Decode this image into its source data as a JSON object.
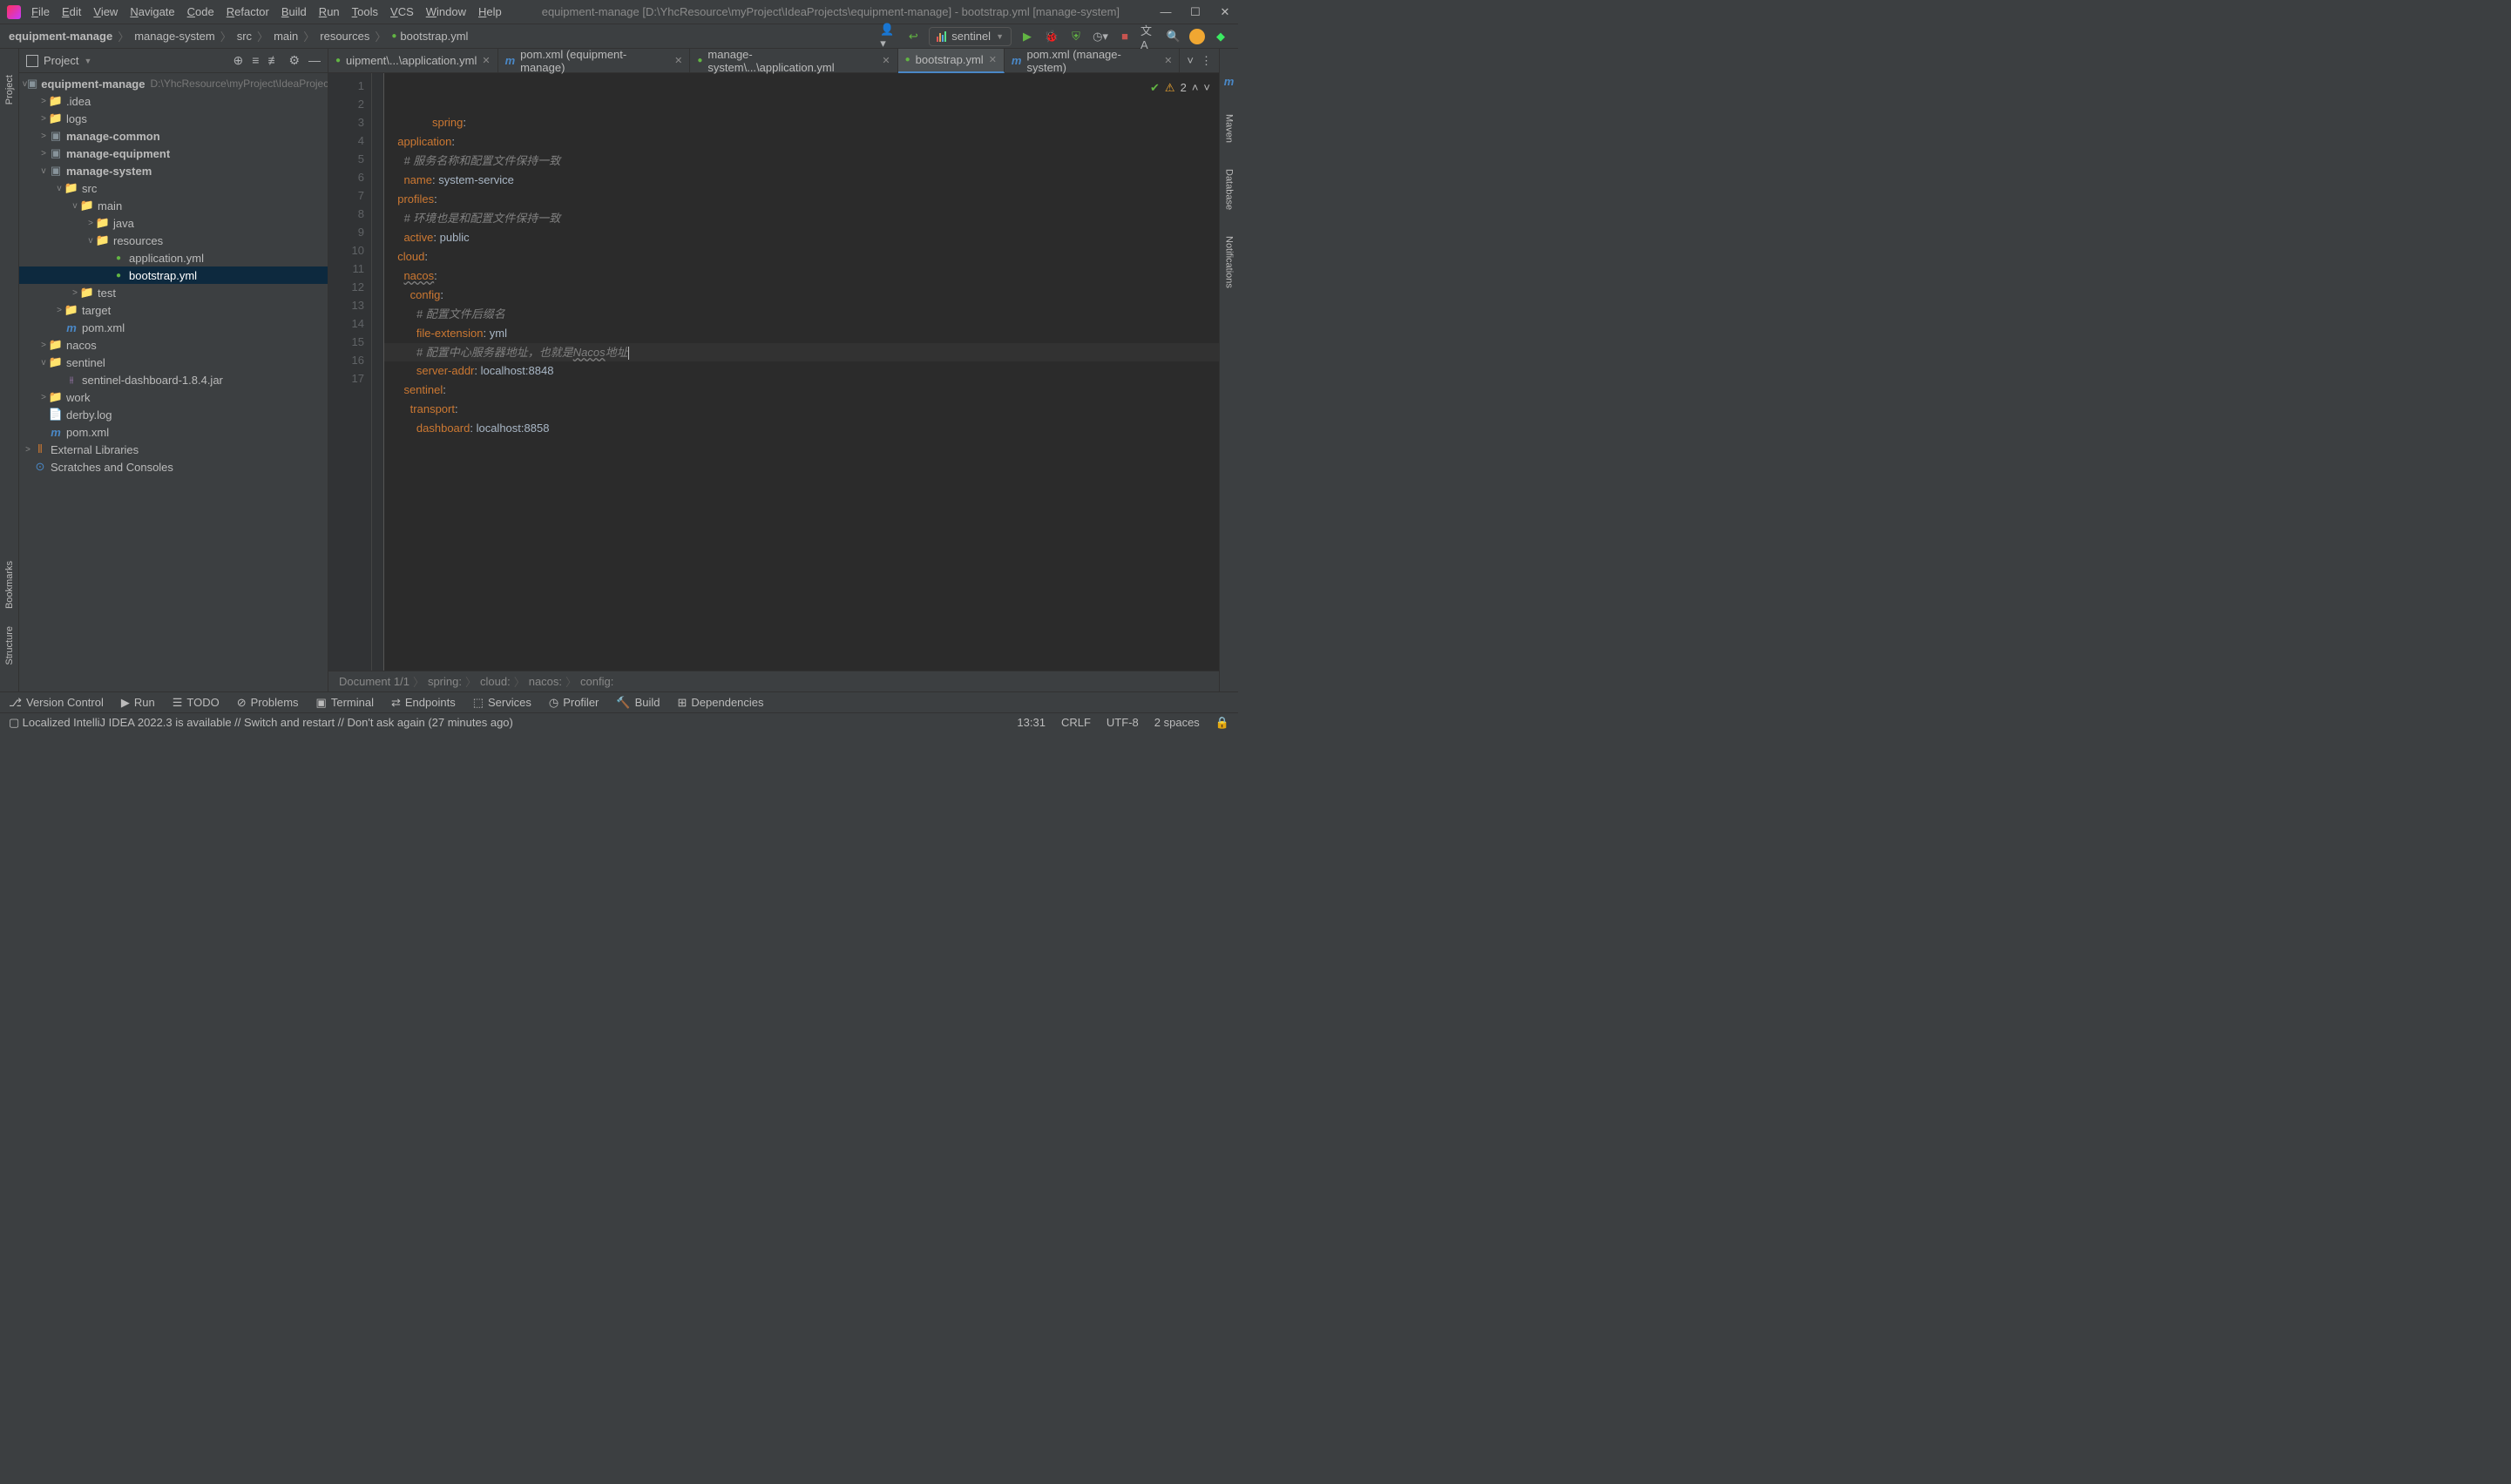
{
  "titlebar": {
    "menus": [
      "File",
      "Edit",
      "View",
      "Navigate",
      "Code",
      "Refactor",
      "Build",
      "Run",
      "Tools",
      "VCS",
      "Window",
      "Help"
    ],
    "title": "equipment-manage [D:\\YhcResource\\myProject\\IdeaProjects\\equipment-manage] - bootstrap.yml [manage-system]"
  },
  "breadcrumb": [
    "equipment-manage",
    "manage-system",
    "src",
    "main",
    "resources",
    "bootstrap.yml"
  ],
  "run_config": "sentinel",
  "sidebar": {
    "title": "Project",
    "root": {
      "name": "equipment-manage",
      "path": "D:\\YhcResource\\myProject\\IdeaProjects\\equipment-manage"
    },
    "items": [
      {
        "lvl": 1,
        "arrow": ">",
        "type": "folder",
        "label": ".idea"
      },
      {
        "lvl": 1,
        "arrow": ">",
        "type": "folder",
        "label": "logs"
      },
      {
        "lvl": 1,
        "arrow": ">",
        "type": "module",
        "label": "manage-common"
      },
      {
        "lvl": 1,
        "arrow": ">",
        "type": "module",
        "label": "manage-equipment"
      },
      {
        "lvl": 1,
        "arrow": "v",
        "type": "module",
        "label": "manage-system"
      },
      {
        "lvl": 2,
        "arrow": "v",
        "type": "src",
        "label": "src"
      },
      {
        "lvl": 3,
        "arrow": "v",
        "type": "src",
        "label": "main"
      },
      {
        "lvl": 4,
        "arrow": ">",
        "type": "src",
        "label": "java"
      },
      {
        "lvl": 4,
        "arrow": "v",
        "type": "res",
        "label": "resources"
      },
      {
        "lvl": 5,
        "arrow": "",
        "type": "yml",
        "label": "application.yml"
      },
      {
        "lvl": 5,
        "arrow": "",
        "type": "yml",
        "label": "bootstrap.yml",
        "selected": true
      },
      {
        "lvl": 3,
        "arrow": ">",
        "type": "folder",
        "label": "test"
      },
      {
        "lvl": 2,
        "arrow": ">",
        "type": "target",
        "label": "target"
      },
      {
        "lvl": 2,
        "arrow": "",
        "type": "pom",
        "label": "pom.xml"
      },
      {
        "lvl": 1,
        "arrow": ">",
        "type": "folder",
        "label": "nacos"
      },
      {
        "lvl": 1,
        "arrow": "v",
        "type": "folder",
        "label": "sentinel"
      },
      {
        "lvl": 2,
        "arrow": "",
        "type": "jar",
        "label": "sentinel-dashboard-1.8.4.jar"
      },
      {
        "lvl": 1,
        "arrow": ">",
        "type": "folder",
        "label": "work"
      },
      {
        "lvl": 1,
        "arrow": "",
        "type": "file",
        "label": "derby.log"
      },
      {
        "lvl": 1,
        "arrow": "",
        "type": "pom",
        "label": "pom.xml"
      }
    ],
    "ext_lib": "External Libraries",
    "scratches": "Scratches and Consoles"
  },
  "tabs": [
    {
      "label": "uipment\\...\\application.yml",
      "type": "yml",
      "active": false
    },
    {
      "label": "pom.xml (equipment-manage)",
      "type": "pom",
      "active": false
    },
    {
      "label": "manage-system\\...\\application.yml",
      "type": "yml",
      "active": false
    },
    {
      "label": "bootstrap.yml",
      "type": "yml",
      "active": true
    },
    {
      "label": "pom.xml (manage-system)",
      "type": "pom",
      "active": false
    }
  ],
  "code": {
    "lines": [
      {
        "n": 1,
        "html": "<span class='k'>spring</span>:"
      },
      {
        "n": 2,
        "html": "  <span class='k'>application</span>:"
      },
      {
        "n": 3,
        "html": "    <span class='c'># 服务名称和配置文件保持一致</span>"
      },
      {
        "n": 4,
        "html": "    <span class='k'>name</span>: system-service"
      },
      {
        "n": 5,
        "html": "  <span class='k'>profiles</span>:"
      },
      {
        "n": 6,
        "html": "    <span class='c'># 环境也是和配置文件保持一致</span>"
      },
      {
        "n": 7,
        "html": "    <span class='k'>active</span>: public"
      },
      {
        "n": 8,
        "html": "  <span class='k'>cloud</span>:"
      },
      {
        "n": 9,
        "html": "    <span class='k u'>nacos</span>:"
      },
      {
        "n": 10,
        "html": "      <span class='k'>config</span>:"
      },
      {
        "n": 11,
        "html": "        <span class='c'># 配置文件后缀名</span>"
      },
      {
        "n": 12,
        "html": "        <span class='k'>file-extension</span>: yml"
      },
      {
        "n": 13,
        "html": "        <span class='c'># 配置中心服务器地址，也就是<span class='u'>Nacos</span>地址</span><span class='caret'></span>",
        "hl": true
      },
      {
        "n": 14,
        "html": "        <span class='k'>server-addr</span>: localhost:8848"
      },
      {
        "n": 15,
        "html": "    <span class='k'>sentinel</span>:"
      },
      {
        "n": 16,
        "html": "      <span class='k'>transport</span>:"
      },
      {
        "n": 17,
        "html": "        <span class='k'>dashboard</span>: localhost:8858"
      }
    ]
  },
  "problems_count": "2",
  "editor_breadcrumb": [
    "Document 1/1",
    "spring:",
    "cloud:",
    "nacos:",
    "config:"
  ],
  "bottom_tools": [
    "Version Control",
    "Run",
    "TODO",
    "Problems",
    "Terminal",
    "Endpoints",
    "Services",
    "Profiler",
    "Build",
    "Dependencies"
  ],
  "status": {
    "msg": "Localized IntelliJ IDEA 2022.3 is available // Switch and restart // Don't ask again (27 minutes ago)",
    "time": "13:31",
    "eol": "CRLF",
    "enc": "UTF-8",
    "indent": "2 spaces"
  },
  "left_tools": [
    "Project"
  ],
  "left_tools2": [
    "Bookmarks",
    "Structure"
  ],
  "right_tools": [
    "Maven",
    "Database",
    "Notifications"
  ],
  "right_m": "m"
}
